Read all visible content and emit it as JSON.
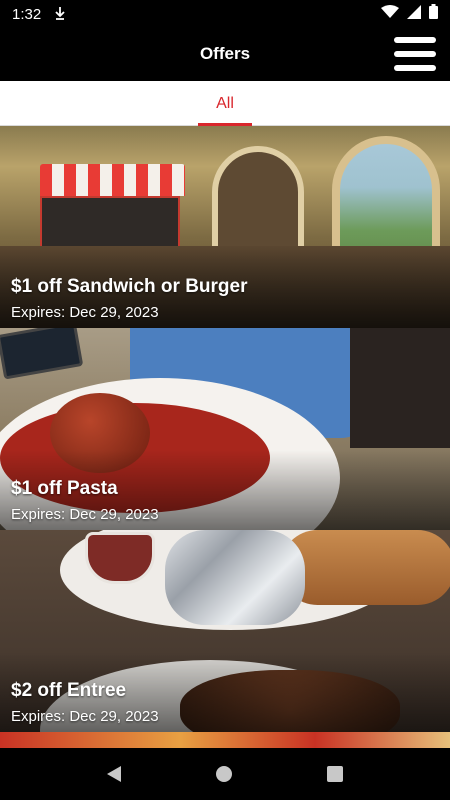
{
  "status_bar": {
    "time": "1:32"
  },
  "app_bar": {
    "title": "Offers"
  },
  "tabs": [
    {
      "label": "All",
      "selected": true
    }
  ],
  "offers": [
    {
      "title": "$1 off Sandwich or Burger",
      "expiry": "Expires: Dec 29, 2023"
    },
    {
      "title": "$1 off Pasta",
      "expiry": "Expires: Dec 29, 2023"
    },
    {
      "title": "$2 off Entree",
      "expiry": "Expires: Dec 29, 2023"
    }
  ],
  "colors": {
    "accent": "#d9262c",
    "bar_background": "#000000",
    "tab_background": "#ffffff"
  },
  "icons": {
    "status_left": "download-icon",
    "wifi": "wifi-icon",
    "signal": "signal-icon",
    "battery": "battery-icon",
    "menu": "hamburger-menu-icon",
    "nav_back": "back-icon",
    "nav_home": "home-icon",
    "nav_recent": "recent-apps-icon"
  }
}
